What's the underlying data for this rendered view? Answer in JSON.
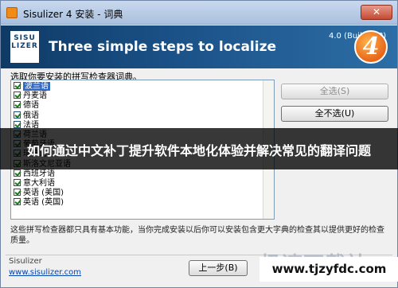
{
  "window": {
    "title": "Sisulizer 4 安装 - 词典",
    "close_glyph": "✕"
  },
  "banner": {
    "logo_line1": "SISU",
    "logo_line2": "LIZER",
    "headline": "Three simple steps to localize",
    "version": "4.0 (Build 3??)",
    "badge": "4"
  },
  "dialog": {
    "prompt": "选取你要安装的拼写检查器词典。",
    "items": [
      {
        "label": "波兰语",
        "checked": true,
        "selected": true
      },
      {
        "label": "丹麦语",
        "checked": true
      },
      {
        "label": "德语",
        "checked": true
      },
      {
        "label": "俄语",
        "checked": true
      },
      {
        "label": "法语",
        "checked": true
      },
      {
        "label": "荷兰语",
        "checked": true
      },
      {
        "label": "葡萄牙语",
        "checked": true
      },
      {
        "label": "瑞典语",
        "checked": true
      },
      {
        "label": "斯洛文尼亚语",
        "checked": true
      },
      {
        "label": "西班牙语",
        "checked": true
      },
      {
        "label": "意大利语",
        "checked": true
      },
      {
        "label": "英语 (美国)",
        "checked": true
      },
      {
        "label": "英语 (英国)",
        "checked": true
      }
    ],
    "select_all_button": "全选(S)",
    "deselect_all_button": "全不选(U)",
    "note": "这些拼写检查器都只具有基本功能，当你完成安装以后你可以安装包含更大字典的检查其以提供更好的检查质量。"
  },
  "overlay": {
    "headline": "如何通过中文补丁提升软件本地化体验并解决常见的翻译问题"
  },
  "footer": {
    "brand": "Sisulizer",
    "link": "www.sisulizer.com",
    "back_button": "上一步(B)",
    "watermark": "极速下载站",
    "site_overlay": "www.tjzyfdc.com"
  }
}
